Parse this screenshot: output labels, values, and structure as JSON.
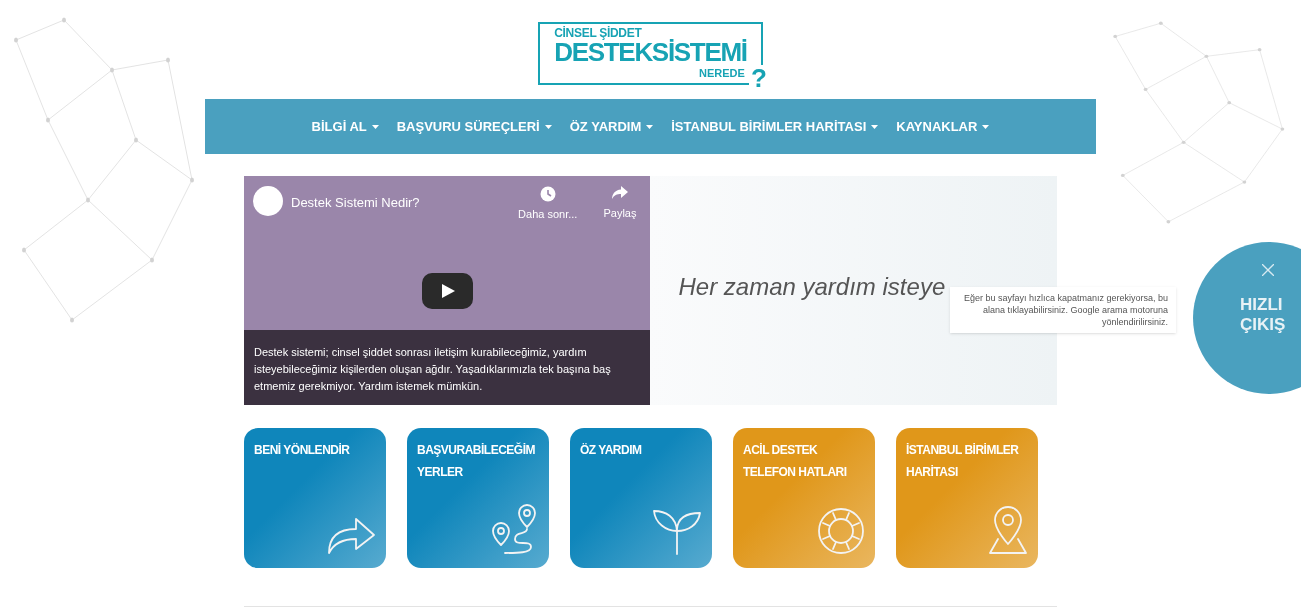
{
  "logo": {
    "line_1": "CİNSEL ŞİDDET",
    "line_2": "DESTEKSİSTEMİ",
    "line_3": "NEREDE",
    "mark": "?"
  },
  "nav": [
    {
      "label": "BİLGİ AL"
    },
    {
      "label": "BAŞVURU SÜREÇLERİ"
    },
    {
      "label": "ÖZ YARDIM"
    },
    {
      "label": "İSTANBUL BİRİMLER HARİTASI"
    },
    {
      "label": "KAYNAKLAR"
    }
  ],
  "video": {
    "title": "Destek Sistemi Nedir?",
    "watch_later": "Daha sonr...",
    "share": "Paylaş",
    "caption": "Destek sistemi; cinsel şiddet sonrası iletişim kurabileceğimiz, yardım isteyebileceğimiz kişilerden oluşan ağdır. Yaşadıklarımızla tek başına baş etmemiz gerekmiyor. Yardım istemek mümkün."
  },
  "banner": {
    "text": "Her zaman yardım isteye"
  },
  "tooltip": {
    "text": "Eğer bu sayfayı hızlıca kapatmanız gerekiyorsa, bu alana tıklayabilirsiniz. Google arama motoruna yönlendirilirsiniz."
  },
  "quick_exit": {
    "label_1": "HIZLI",
    "label_2": "ÇIKIŞ"
  },
  "tiles": [
    {
      "kind": "arrow",
      "title": "BENİ YÖNLENDİR",
      "color": "#0f86bb"
    },
    {
      "kind": "route",
      "title": "BAŞVURABİLECEĞİM YERLER",
      "color": "#0f86bb"
    },
    {
      "kind": "sprout",
      "title": "ÖZ YARDIM",
      "color": "#0f86bb"
    },
    {
      "kind": "lifebuoy",
      "title": "ACİL DESTEK TELEFON HATLARI",
      "color": "#e0971a"
    },
    {
      "kind": "pin",
      "title": "İSTANBUL BİRİMLER HARİTASI",
      "color": "#e0971a"
    }
  ]
}
